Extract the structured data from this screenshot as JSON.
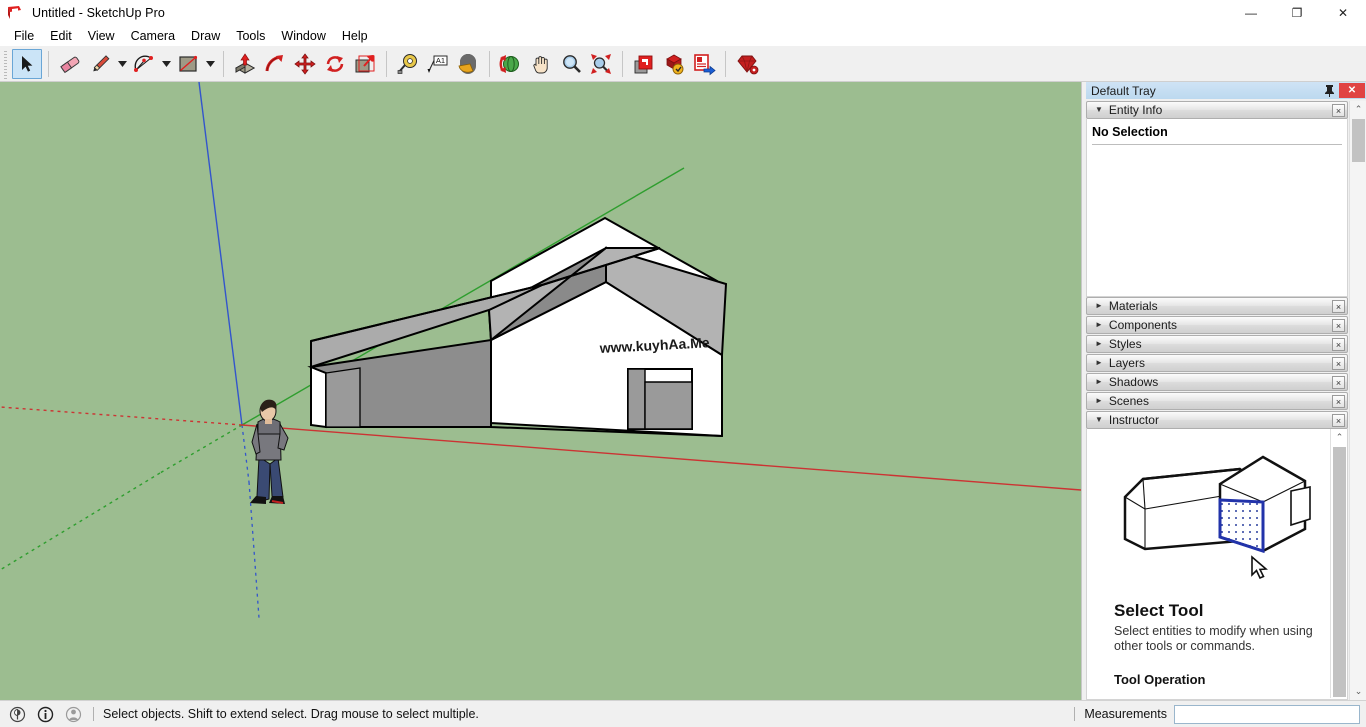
{
  "window": {
    "title": "Untitled - SketchUp Pro",
    "logo_icon": "sketchup-logo-icon",
    "controls": [
      {
        "name": "minimize-button",
        "glyph": "—"
      },
      {
        "name": "maximize-button",
        "glyph": "❐"
      },
      {
        "name": "close-button",
        "glyph": "✕"
      }
    ]
  },
  "menubar": {
    "items": [
      "File",
      "Edit",
      "View",
      "Camera",
      "Draw",
      "Tools",
      "Window",
      "Help"
    ]
  },
  "toolbar": {
    "groups": [
      {
        "tools": [
          {
            "name": "select-tool",
            "label": "Select",
            "icon": "arrow-cursor-icon",
            "active": true
          },
          {
            "name": "eraser-tool",
            "label": "Eraser",
            "icon": "eraser-icon",
            "active": false
          },
          {
            "name": "line-tool",
            "label": "Line",
            "icon": "pencil-icon",
            "active": false,
            "dropdown": true
          },
          {
            "name": "arc-tool",
            "label": "Arc",
            "icon": "arc-icon",
            "active": false,
            "dropdown": true
          },
          {
            "name": "rectangle-tool",
            "label": "Rectangle",
            "icon": "rectangle-icon",
            "active": false,
            "dropdown": true
          }
        ]
      },
      {
        "tools": [
          {
            "name": "push-pull-tool",
            "label": "Push/Pull",
            "icon": "push-pull-icon",
            "active": false
          },
          {
            "name": "follow-me-tool",
            "label": "Follow Me",
            "icon": "follow-me-icon",
            "active": false
          },
          {
            "name": "move-tool",
            "label": "Move",
            "icon": "move-arrows-icon",
            "active": false
          },
          {
            "name": "rotate-tool",
            "label": "Rotate",
            "icon": "rotate-icon",
            "active": false
          },
          {
            "name": "scale-tool",
            "label": "Scale",
            "icon": "scale-icon",
            "active": false
          }
        ]
      },
      {
        "tools": [
          {
            "name": "tape-measure-tool",
            "label": "Tape Measure",
            "icon": "tape-measure-icon",
            "active": false
          },
          {
            "name": "text-tool",
            "label": "Text",
            "icon": "text-a1-icon",
            "active": false
          },
          {
            "name": "paint-bucket-tool",
            "label": "Paint Bucket",
            "icon": "paint-bucket-icon",
            "active": false
          }
        ]
      },
      {
        "tools": [
          {
            "name": "orbit-tool",
            "label": "Orbit",
            "icon": "orbit-icon",
            "active": false
          },
          {
            "name": "pan-tool",
            "label": "Pan",
            "icon": "hand-icon",
            "active": false
          },
          {
            "name": "zoom-tool",
            "label": "Zoom",
            "icon": "magnifier-icon",
            "active": false
          },
          {
            "name": "zoom-extents-tool",
            "label": "Zoom Extents",
            "icon": "zoom-extents-icon",
            "active": false
          }
        ]
      },
      {
        "tools": [
          {
            "name": "3d-warehouse-tool",
            "label": "3D Warehouse",
            "icon": "warehouse-icon",
            "active": false
          },
          {
            "name": "extension-warehouse-tool",
            "label": "Extension Warehouse",
            "icon": "extension-warehouse-icon",
            "active": false
          },
          {
            "name": "share-model-tool",
            "label": "Share Model",
            "icon": "share-model-icon",
            "active": false
          }
        ]
      },
      {
        "tools": [
          {
            "name": "ruby-console-tool",
            "label": "Ruby",
            "icon": "ruby-gem-icon",
            "active": false
          }
        ]
      }
    ]
  },
  "viewport": {
    "background_color": "#9cbd90",
    "axes": {
      "x_color": "#cc3333",
      "y_color": "#2e9e2e",
      "z_color": "#3355cc",
      "origin_label": "model-origin"
    },
    "model": {
      "name": "house-model",
      "watermark_text": "www.kuyhAa.Me",
      "face_fill": "#ffffff",
      "roof_fill_light": "#b3b3b3",
      "roof_fill_dark": "#8f8f8f",
      "edge_color": "#000000"
    },
    "scale_figure": {
      "name": "scale-figure-person"
    }
  },
  "tray": {
    "title": "Default Tray",
    "pin_icon": "pin-icon",
    "close_glyph": "✕",
    "panels": [
      {
        "name": "entity-info",
        "label": "Entity Info",
        "expanded": true,
        "close_glyph": "×"
      },
      {
        "name": "materials",
        "label": "Materials",
        "expanded": false,
        "close_glyph": "×"
      },
      {
        "name": "components",
        "label": "Components",
        "expanded": false,
        "close_glyph": "×"
      },
      {
        "name": "styles",
        "label": "Styles",
        "expanded": false,
        "close_glyph": "×"
      },
      {
        "name": "layers",
        "label": "Layers",
        "expanded": false,
        "close_glyph": "×"
      },
      {
        "name": "shadows",
        "label": "Shadows",
        "expanded": false,
        "close_glyph": "×"
      },
      {
        "name": "scenes",
        "label": "Scenes",
        "expanded": false,
        "close_glyph": "×"
      },
      {
        "name": "instructor",
        "label": "Instructor",
        "expanded": true,
        "close_glyph": "×"
      }
    ],
    "entity_info": {
      "empty_text": "No Selection"
    },
    "instructor": {
      "illustration": "house-select-face-illustration",
      "cursor_icon": "arrow-cursor-icon",
      "title": "Select Tool",
      "description": "Select entities to modify when using other tools or commands.",
      "section_heading": "Tool Operation"
    },
    "scroll_up_glyph": "⌃",
    "scroll_down_glyph": "⌄"
  },
  "statusbar": {
    "icons": [
      "geo-location-icon",
      "info-circle-icon",
      "person-credits-icon"
    ],
    "hint": "Select objects. Shift to extend select. Drag mouse to select multiple.",
    "measurements_label": "Measurements",
    "measurements_value": "",
    "measurements_placeholder": ""
  }
}
